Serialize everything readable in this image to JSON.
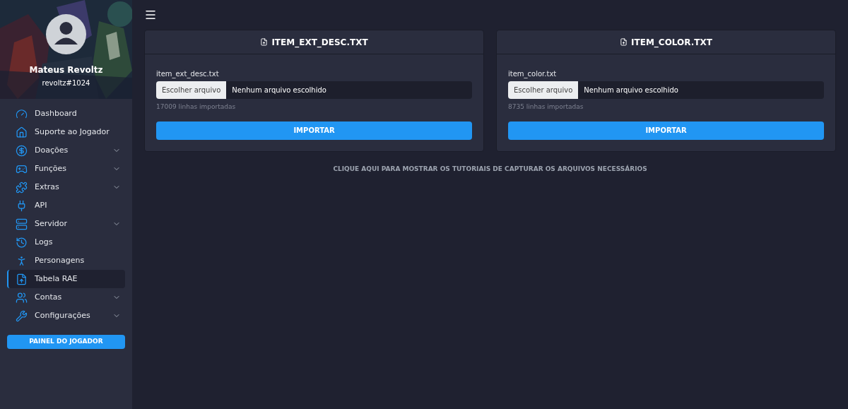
{
  "user": {
    "name": "Mateus Revoltz",
    "handle": "revoltz#1024"
  },
  "menu": [
    {
      "label": "Dashboard",
      "selected": false,
      "submenu": false
    },
    {
      "label": "Suporte ao Jogador",
      "selected": false,
      "submenu": false
    },
    {
      "label": "Doações",
      "selected": false,
      "submenu": true
    },
    {
      "label": "Funções",
      "selected": false,
      "submenu": true
    },
    {
      "label": "Extras",
      "selected": false,
      "submenu": true
    },
    {
      "label": "API",
      "selected": false,
      "submenu": false
    },
    {
      "label": "Servidor",
      "selected": false,
      "submenu": true
    },
    {
      "label": "Logs",
      "selected": false,
      "submenu": false
    },
    {
      "label": "Personagens",
      "selected": false,
      "submenu": false
    },
    {
      "label": "Tabela RAE",
      "selected": true,
      "submenu": false
    },
    {
      "label": "Contas",
      "selected": false,
      "submenu": true
    },
    {
      "label": "Configurações",
      "selected": false,
      "submenu": true
    }
  ],
  "player_panel_button": "PAINEL DO JOGADOR",
  "cards": [
    {
      "title": "ITEM_EXT_DESC.TXT",
      "field_label": "item_ext_desc.txt",
      "choose_button": "Escolher arquivo",
      "file_status": "Nenhum arquivo escolhido",
      "hint": "17009 linhas importadas",
      "button": "IMPORTAR"
    },
    {
      "title": "ITEM_COLOR.TXT",
      "field_label": "item_color.txt",
      "choose_button": "Escolher arquivo",
      "file_status": "Nenhum arquivo escolhido",
      "hint": "8735 linhas importadas",
      "button": "IMPORTAR"
    }
  ],
  "tutorial_link": "CLIQUE AQUI PARA MOSTRAR OS TUTORIAIS DE CAPTURAR OS ARQUIVOS NECESSÁRIOS"
}
